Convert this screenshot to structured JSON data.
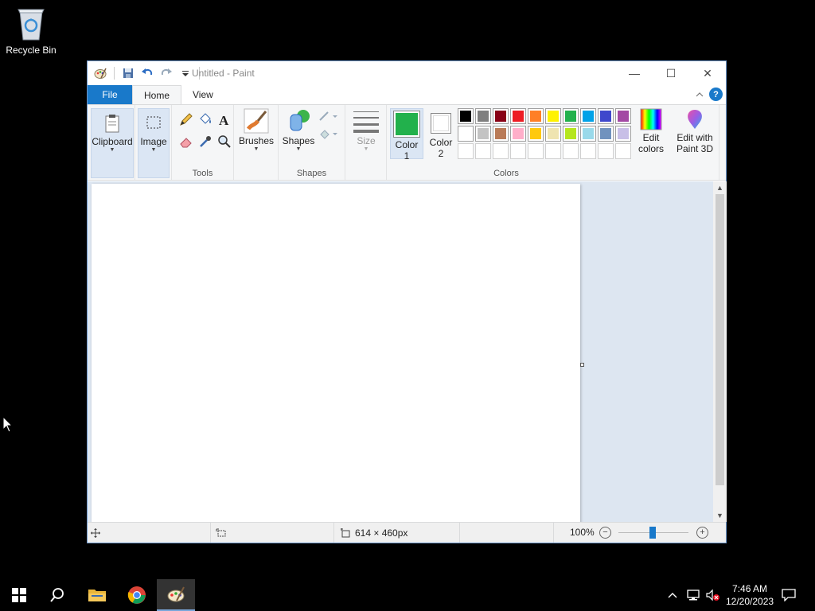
{
  "desktop": {
    "recycle_bin_label": "Recycle Bin"
  },
  "window": {
    "title": "Untitled - Paint",
    "minimize_glyph": "—",
    "maximize_glyph": "☐",
    "close_glyph": "✕"
  },
  "tabs": {
    "file": "File",
    "home": "Home",
    "view": "View",
    "help": "?"
  },
  "ribbon": {
    "clipboard": "Clipboard",
    "image": "Image",
    "tools_group": "Tools",
    "brushes": "Brushes",
    "shapes_btn": "Shapes",
    "shapes_group": "Shapes",
    "size": "Size",
    "color1_line1": "Color",
    "color1_line2": "1",
    "color2_line1": "Color",
    "color2_line2": "2",
    "colors_group": "Colors",
    "edit_colors_line1": "Edit",
    "edit_colors_line2": "colors",
    "paint3d_line1": "Edit with",
    "paint3d_line2": "Paint 3D"
  },
  "colors": {
    "color1": "#22b14c",
    "color2": "#ffffff",
    "palette": [
      "#000000",
      "#7f7f7f",
      "#880015",
      "#ed1c24",
      "#ff7f27",
      "#fff200",
      "#22b14c",
      "#00a2e8",
      "#3f48cc",
      "#a349a4",
      "#ffffff",
      "#c3c3c3",
      "#b97a57",
      "#ffaec9",
      "#ffc90e",
      "#efe4b0",
      "#b5e61d",
      "#99d9ea",
      "#7092be",
      "#c8bfe7",
      "#ffffff",
      "#ffffff",
      "#ffffff",
      "#ffffff",
      "#ffffff",
      "#ffffff",
      "#ffffff",
      "#ffffff",
      "#ffffff",
      "#ffffff"
    ]
  },
  "statusbar": {
    "image_size": "614 × 460px",
    "zoom": "100%",
    "zoom_out": "−",
    "zoom_in": "+"
  },
  "taskbar": {
    "time": "7:46 AM",
    "date": "12/20/2023"
  }
}
